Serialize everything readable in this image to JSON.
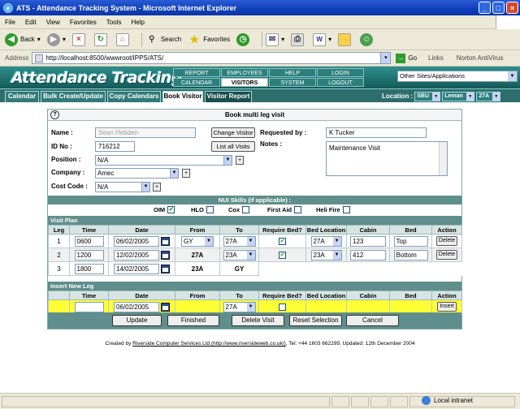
{
  "window": {
    "title": "ATS - Attendance Tracking System - Microsoft Internet Explorer"
  },
  "menu": [
    "File",
    "Edit",
    "View",
    "Favorites",
    "Tools",
    "Help"
  ],
  "toolbar": {
    "back": "Back",
    "search": "Search",
    "favorites": "Favorites"
  },
  "address": {
    "label": "Address",
    "url": "http://localhost:8500/wwwroot/IPPS/ATS/",
    "go": "Go",
    "links": "Links",
    "norton": "Norton AntiVirus"
  },
  "app": {
    "logo": "Attendance Tracking",
    "nav": [
      {
        "label": "REPORT",
        "active": false
      },
      {
        "label": "EMPLOYEES",
        "active": false
      },
      {
        "label": "HELP",
        "active": false
      },
      {
        "label": "LOGIN",
        "active": false
      },
      {
        "label": "CALENDAR",
        "active": false
      },
      {
        "label": "VISITORS",
        "active": true
      },
      {
        "label": "SYSTEM",
        "active": false
      },
      {
        "label": "LOGOUT",
        "active": false
      }
    ],
    "other_sites": "Other Sites/Applications"
  },
  "tabs": [
    "Calendar",
    "Bulk Create/Update",
    "Copy Calendars",
    "Book Visitor",
    "Visitor Report"
  ],
  "location": {
    "label": "Location :",
    "values": [
      "SBU",
      "Leman",
      "27A"
    ]
  },
  "form": {
    "title": "Book multi leg visit",
    "name_label": "Name :",
    "name_value": "Sean Hebden",
    "change_visitor": "Change Visitor",
    "requested_by_label": "Requested by :",
    "requested_by_value": "K Tucker",
    "id_label": "ID No :",
    "id_value": "716212",
    "list_visits": "List all Visits",
    "notes_label": "Notes :",
    "notes_value": "Maintenance Visit",
    "position_label": "Position :",
    "position_value": "N/A",
    "company_label": "Company :",
    "company_value": "Amec",
    "cost_code_label": "Cost Code :",
    "cost_code_value": "N/A",
    "plus": "+"
  },
  "skills": {
    "title": "NUI Skills (if applicable) :",
    "items": [
      {
        "label": "OIM",
        "checked": true
      },
      {
        "label": "HLO",
        "checked": false
      },
      {
        "label": "Cox",
        "checked": false
      },
      {
        "label": "First Aid",
        "checked": false
      },
      {
        "label": "Heli Fire",
        "checked": false
      }
    ]
  },
  "visit_plan": {
    "title": "Visit Plan",
    "columns": [
      "Leg",
      "Time",
      "Date",
      "From",
      "To",
      "Require Bed?",
      "Bed Location",
      "Cabin",
      "Bed",
      "Action"
    ],
    "rows": [
      {
        "leg": "1",
        "time": "0600",
        "date": "06/02/2005",
        "from": "GY",
        "to": "27A",
        "bed": true,
        "bed_location": "27A",
        "cabin": "123",
        "bed_name": "Top",
        "action": "Delete"
      },
      {
        "leg": "2",
        "time": "1200",
        "date": "12/02/2005",
        "from": "27A",
        "to": "23A",
        "bed": true,
        "bed_location": "23A",
        "cabin": "412",
        "bed_name": "Bottom",
        "action": "Delete"
      },
      {
        "leg": "3",
        "time": "1800",
        "date": "14/02/2005",
        "from": "23A",
        "to": "GY"
      }
    ]
  },
  "new_leg": {
    "title": "Insert New Leg",
    "columns": [
      "",
      "Time",
      "Date",
      "From",
      "To",
      "Require Bed?",
      "Bed Location",
      "Cabin",
      "Bed",
      "Action"
    ],
    "time": "",
    "date": "06/02/2005",
    "to": "27A",
    "action": "Insert"
  },
  "actions": [
    "Update",
    "Finished",
    "Delete Visit",
    "Reset Selection",
    "Cancel"
  ],
  "footer": {
    "prefix": "Created by ",
    "company": "Riverside Computer Services Ltd (http://www.riversideweb.co.uk/)",
    "suffix": ", Tel: +44 1603 662299, Updated: 12th December 2004"
  },
  "status": {
    "zone": "Local intranet"
  }
}
